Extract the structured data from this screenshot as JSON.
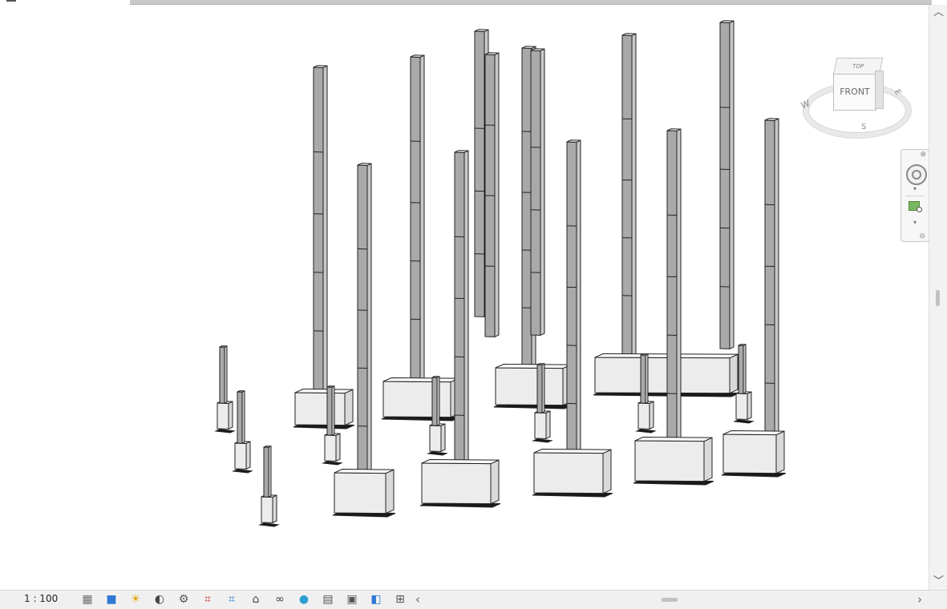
{
  "status_bar": {
    "scale": "1 : 100",
    "tools": [
      {
        "name": "detail-level-icon",
        "glyph": "▦"
      },
      {
        "name": "visual-style-icon",
        "glyph": "■"
      },
      {
        "name": "sun-path-icon",
        "glyph": "☀"
      },
      {
        "name": "shadows-icon",
        "glyph": "◐"
      },
      {
        "name": "render-dialog-icon",
        "glyph": "⚙"
      },
      {
        "name": "crop-view-icon",
        "glyph": "⌗"
      },
      {
        "name": "show-crop-region-icon",
        "glyph": "⌗"
      },
      {
        "name": "unlocked-3d-view-icon",
        "glyph": "⌂"
      },
      {
        "name": "temporary-hide-isolate-icon",
        "glyph": "∞"
      },
      {
        "name": "reveal-hidden-elements-icon",
        "glyph": "●"
      },
      {
        "name": "temporary-view-properties-icon",
        "glyph": "▤"
      },
      {
        "name": "worksharing-display-icon",
        "glyph": "▣"
      },
      {
        "name": "analytical-model-icon",
        "glyph": "◧"
      },
      {
        "name": "highlight-displacement-icon",
        "glyph": "⊞"
      }
    ],
    "scroll_left": "‹",
    "scroll_right": "›"
  },
  "viewcube": {
    "top_label": "TOP",
    "front_label": "FRONT",
    "compass_w": "W",
    "compass_e": "E",
    "compass_s": "S"
  },
  "navigation_bar": {
    "close": "⊗",
    "minimize": "⊖",
    "dropdown": "▾"
  },
  "vertical_scroll": {
    "up": "︿",
    "down": "﹀"
  },
  "colors": {
    "column_face": "#a9a9a9",
    "column_side": "#c8c8c8",
    "footing_face": "#ececec",
    "footing_side": "#d9d9d9",
    "outline": "#222222"
  }
}
